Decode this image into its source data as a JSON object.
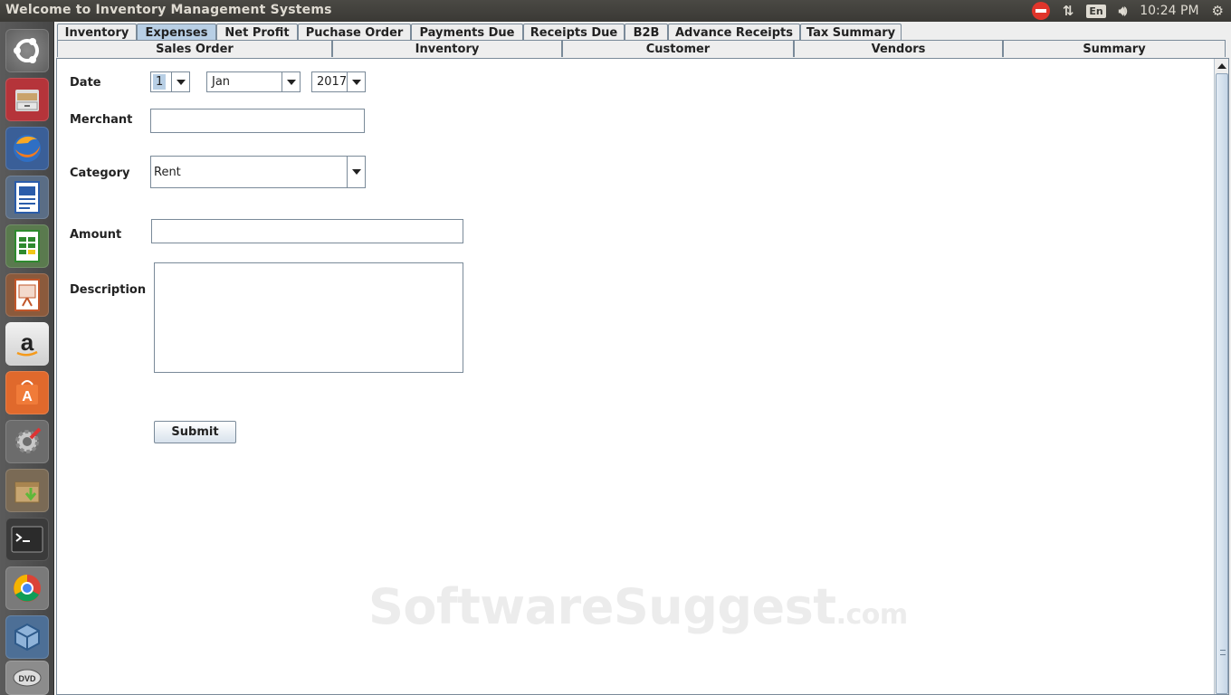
{
  "window": {
    "title": "Welcome to Inventory Management Systems"
  },
  "system_tray": {
    "language": "En",
    "time": "10:24 PM"
  },
  "tabs_top": [
    {
      "label": "Inventory"
    },
    {
      "label": "Expenses",
      "selected": true
    },
    {
      "label": "Net Profit"
    },
    {
      "label": "Puchase Order"
    },
    {
      "label": "Payments Due"
    },
    {
      "label": "Receipts Due"
    },
    {
      "label": "B2B"
    },
    {
      "label": "Advance Receipts"
    },
    {
      "label": "Tax Summary"
    }
  ],
  "tabs_sub": [
    {
      "label": "Sales Order"
    },
    {
      "label": "Inventory"
    },
    {
      "label": "Customer"
    },
    {
      "label": "Vendors"
    },
    {
      "label": "Summary"
    }
  ],
  "form": {
    "date_label": "Date",
    "day": "1",
    "month": "Jan",
    "year": "2017",
    "merchant_label": "Merchant",
    "merchant_value": "",
    "category_label": "Category",
    "category_value": "Rent",
    "amount_label": "Amount",
    "amount_value": "",
    "description_label": "Description",
    "description_value": "",
    "submit_label": "Submit"
  },
  "watermark": {
    "main": "SoftwareSuggest",
    "suffix": ".com"
  },
  "launcher": [
    {
      "icon": "ubuntu-dash-icon"
    },
    {
      "icon": "file-cabinet-icon"
    },
    {
      "icon": "firefox-icon"
    },
    {
      "icon": "writer-document-icon"
    },
    {
      "icon": "calc-spreadsheet-icon"
    },
    {
      "icon": "impress-presentation-icon"
    },
    {
      "icon": "amazon-icon"
    },
    {
      "icon": "software-center-icon"
    },
    {
      "icon": "system-settings-icon"
    },
    {
      "icon": "archive-install-icon"
    },
    {
      "icon": "terminal-icon"
    },
    {
      "icon": "chrome-icon"
    },
    {
      "icon": "virtualbox-icon"
    },
    {
      "icon": "dvd-icon"
    }
  ]
}
